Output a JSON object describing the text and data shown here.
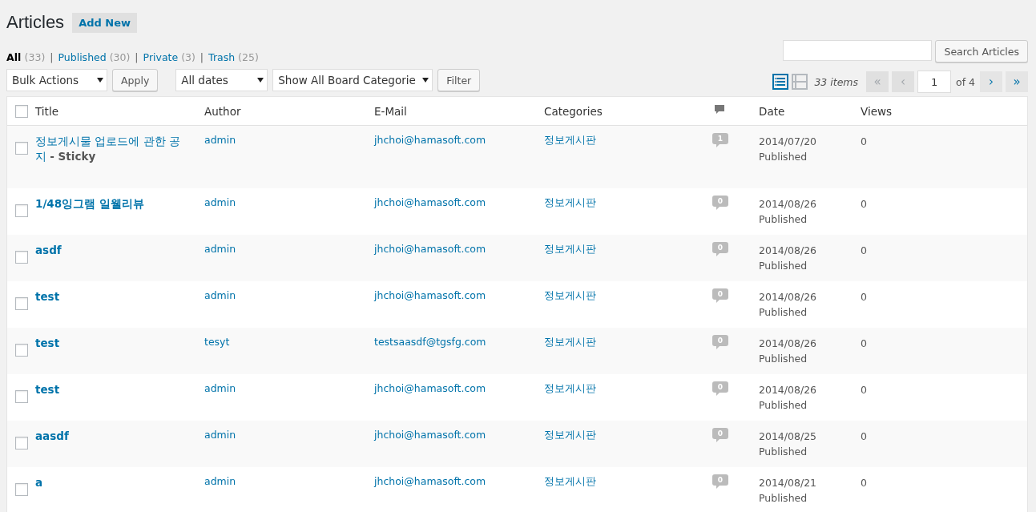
{
  "heading": {
    "title": "Articles",
    "add_new": "Add New"
  },
  "filters": [
    {
      "label": "All",
      "count": "(33)",
      "selected": true
    },
    {
      "separator": "|",
      "label": "Published",
      "count": "(30)",
      "selected": false
    },
    {
      "separator": "|",
      "label": "Private",
      "count": "(3)",
      "selected": false
    },
    {
      "separator": "|",
      "label": "Trash",
      "count": "(25)",
      "selected": false
    }
  ],
  "search": {
    "button": "Search Articles"
  },
  "bulk_actions": {
    "value": "Bulk Actions",
    "apply": "Apply"
  },
  "date_filter": {
    "value": "All dates"
  },
  "category_filter": {
    "value": "Show All Board Categorie",
    "button": "Filter"
  },
  "view_modes": [
    {
      "kind": "list",
      "selected": true
    },
    {
      "kind": "excerpt",
      "selected": false
    }
  ],
  "pagination": {
    "items": "33 items",
    "first": {
      "label": "«",
      "disabled": true
    },
    "prev": {
      "label": "‹",
      "disabled": true
    },
    "page": "1",
    "of": "of 4",
    "next": {
      "label": "›",
      "disabled": false
    },
    "last": {
      "label": "»",
      "disabled": false
    }
  },
  "table": {
    "columns": [
      "Title",
      "Author",
      "E-Mail",
      "Categories",
      "",
      "Date",
      "Views"
    ],
    "header_checked": false,
    "rows": [
      {
        "checked": false,
        "title": "정보게시물 업로드에 관한 공지",
        "state": "- Sticky",
        "author": "admin",
        "email": "jhchoi@hamasoft.com",
        "category": "정보게시판",
        "comments": "1",
        "date": "2014/07/20",
        "status": "Published",
        "views": "0"
      },
      {
        "checked": false,
        "title": "1/48잉그램 일웰리뷰",
        "author": "admin",
        "email": "jhchoi@hamasoft.com",
        "category": "정보게시판",
        "comments": "0",
        "date": "2014/08/26",
        "status": "Published",
        "views": "0"
      },
      {
        "checked": false,
        "title": "asdf",
        "author": "admin",
        "email": "jhchoi@hamasoft.com",
        "category": "정보게시판",
        "comments": "0",
        "date": "2014/08/26",
        "status": "Published",
        "views": "0"
      },
      {
        "checked": false,
        "title": "test",
        "author": "admin",
        "email": "jhchoi@hamasoft.com",
        "category": "정보게시판",
        "comments": "0",
        "date": "2014/08/26",
        "status": "Published",
        "views": "0"
      },
      {
        "checked": false,
        "title": "test",
        "author": "tesyt",
        "email": "testsaasdf@tgsfg.com",
        "category": "정보게시판",
        "comments": "0",
        "date": "2014/08/26",
        "status": "Published",
        "views": "0"
      },
      {
        "checked": false,
        "title": "test",
        "author": "admin",
        "email": "jhchoi@hamasoft.com",
        "category": "정보게시판",
        "comments": "0",
        "date": "2014/08/26",
        "status": "Published",
        "views": "0"
      },
      {
        "checked": false,
        "title": "aasdf",
        "author": "admin",
        "email": "jhchoi@hamasoft.com",
        "category": "정보게시판",
        "comments": "0",
        "date": "2014/08/25",
        "status": "Published",
        "views": "0"
      },
      {
        "checked": false,
        "title": "a",
        "author": "admin",
        "email": "jhchoi@hamasoft.com",
        "category": "정보게시판",
        "comments": "0",
        "date": "2014/08/21",
        "status": "Published",
        "views": "0"
      }
    ]
  }
}
